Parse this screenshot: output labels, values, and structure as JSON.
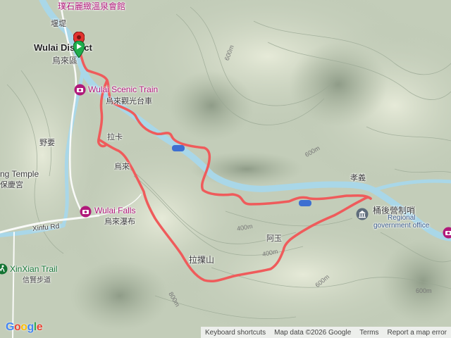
{
  "map": {
    "place_labels": {
      "hotel": "璞石麗緻溫泉會館",
      "dam": "堰堤",
      "district_en": "Wulai District",
      "district_zh": "烏來區",
      "train_en": "Wulai Scenic Train",
      "train_zh": "烏來觀光台車",
      "checkpoint": "拉卡",
      "yeyao": "野要",
      "temple_en": "ng Temple",
      "temple_zh": "保慶宮",
      "wulai_short": "烏來",
      "falls_en": "Wulai Falls",
      "falls_zh": "烏來瀑布",
      "road": "Xinfu Rd",
      "lapushan": "拉擈山",
      "xiaoyi": "孝義",
      "tonghou_zh": "桶後營制哨",
      "regional_1": "Regional",
      "regional_2": "government office",
      "xinxian_en": "XinXian Trail",
      "xinxian_zh": "信賢步道",
      "a_label": "阿玉"
    },
    "contours": {
      "c600a": "600m",
      "c600b": "600m",
      "c400a": "400m",
      "c400b": "400m",
      "c600c": "600m",
      "c800": "800m",
      "c600d": "600m"
    }
  },
  "attribution": {
    "keyboard": "Keyboard shortcuts",
    "mapdata": "Map data ©2026 Google",
    "terms": "Terms",
    "report": "Report a map error"
  },
  "logo": [
    "G",
    "o",
    "o",
    "g",
    "l",
    "e"
  ],
  "colors": {
    "route": "#ef5b5b",
    "river": "#a9d7e8",
    "poi": "#b0197a",
    "trail": "#137333"
  }
}
